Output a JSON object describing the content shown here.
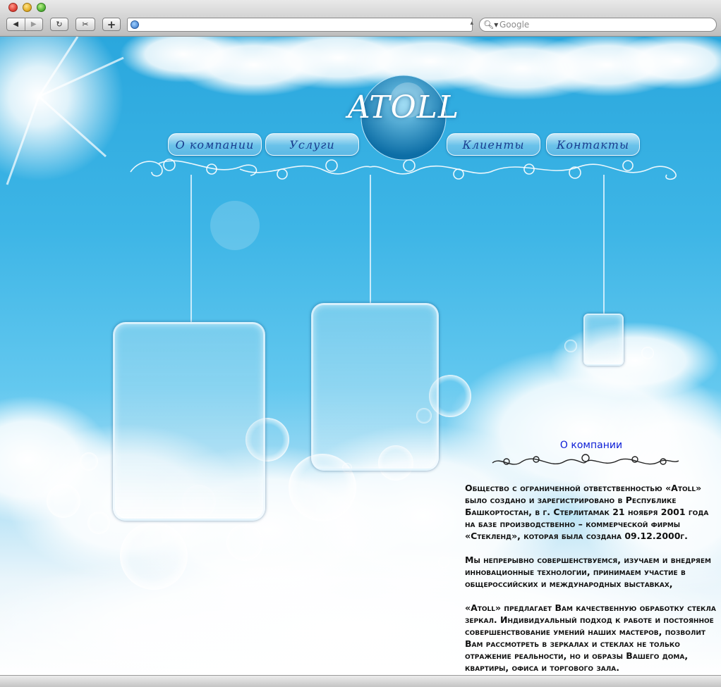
{
  "browser": {
    "back_icon": "back-arrow-icon",
    "forward_icon": "forward-arrow-icon",
    "url_value": "",
    "search_placeholder": "Google"
  },
  "site": {
    "brand": "ATOLL",
    "nav": [
      {
        "label": "О компании"
      },
      {
        "label": "Услуги"
      },
      {
        "label": "Клиенты"
      },
      {
        "label": "Контакты"
      }
    ]
  },
  "about": {
    "title": "О компании",
    "paragraphs": [
      "Общество с ограниченной ответственностью «Atoll» было создано и зарегистрировано в Республике Башкортостан, в г. Стерлитамак 21 ноября 2001 года на базе производственно – коммерческой фирмы «Стекленд», которая была создана 09.12.2000г.",
      "Мы непрерывно совершенствуемся, изучаем и внедряем инновационные технологии, принимаем участие в общероссийских и международных выставках,",
      "«Atoll» предлагает Вам качественную обработку стекла зеркал. Индивидуальный подход к работе и постоянное совершенствование умений наших мастеров, позволит Вам рассмотреть в зеркалах и стеклах не только отражение реальности, но и образы Вашего дома, квартиры, офиса и торгового зала."
    ]
  },
  "colors": {
    "sky_top": "#2aa7dd",
    "nav_text": "#1a3d8f",
    "title_text": "#0b1cd6"
  }
}
